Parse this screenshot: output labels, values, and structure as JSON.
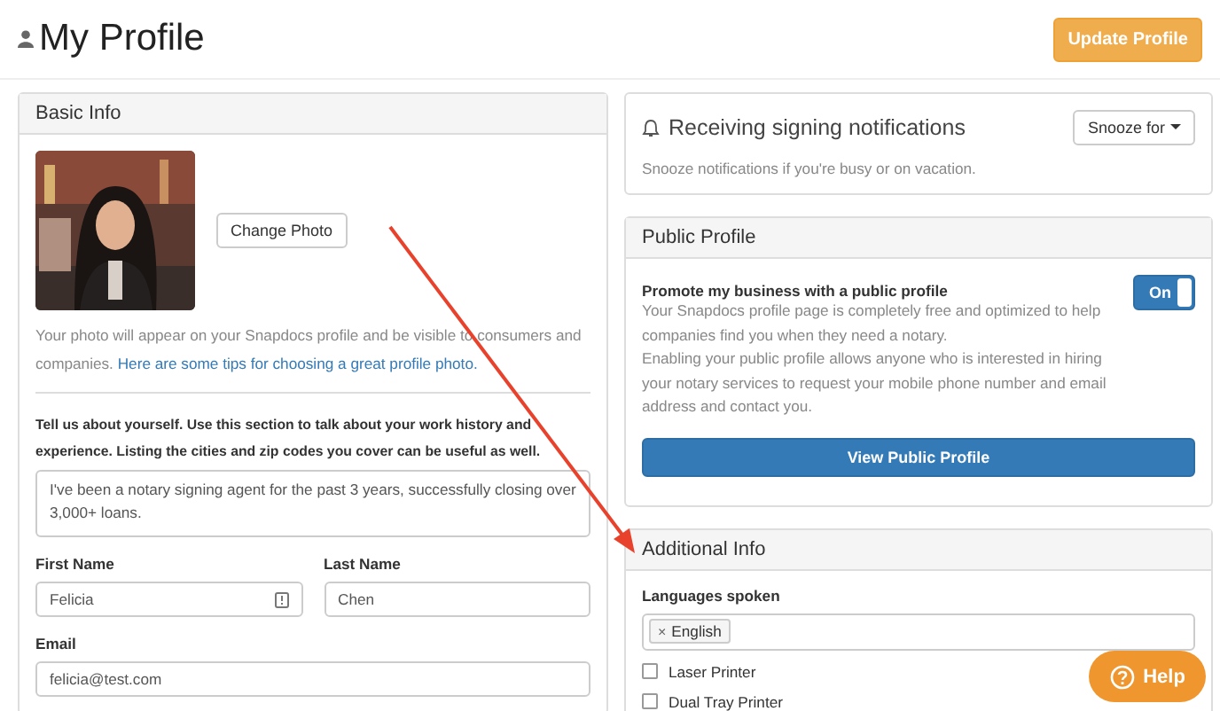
{
  "page": {
    "title": "My Profile",
    "update_button": "Update Profile"
  },
  "basic_info": {
    "title": "Basic Info",
    "change_photo": "Change Photo",
    "photo_note": "Your photo will appear on your Snapdocs profile and be visible to consumers and companies.",
    "photo_link": "Here are some tips for choosing a great profile photo.",
    "about_prompt": "Tell us about yourself. Use this section to talk about your work history and experience. Listing the cities and zip codes you cover can be useful as well.",
    "about_value": "I've been a notary signing agent for the past 3 years, successfully closing over 3,000+ loans.",
    "name_fields": [
      {
        "label": "First Name",
        "value": "Felicia",
        "autofill_icon": true
      },
      {
        "label": "Last Name",
        "value": "Chen",
        "autofill_icon": false
      }
    ],
    "email": {
      "label": "Email",
      "value": "felicia@test.com"
    }
  },
  "notifications": {
    "title": "Receiving signing notifications",
    "snooze_button": "Snooze for",
    "note": "Snooze notifications if you're busy or on vacation."
  },
  "public_profile": {
    "title": "Public Profile",
    "heading": "Promote my business with a public profile",
    "paragraphs": [
      "Your Snapdocs profile page is completely free and optimized to help companies find you when they need a notary.",
      "Enabling your public profile allows anyone who is interested in hiring your notary services to request your mobile phone number and email address and contact you."
    ],
    "toggle": {
      "label": "On",
      "on": true
    },
    "view_button": "View Public Profile"
  },
  "additional_info": {
    "title": "Additional Info",
    "languages_label": "Languages spoken",
    "remove_mark": "×",
    "languages": [
      "English"
    ],
    "checkboxes": [
      {
        "label": "Laser Printer",
        "checked": false
      },
      {
        "label": "Dual Tray Printer",
        "checked": false
      }
    ]
  },
  "help_button": "Help"
}
